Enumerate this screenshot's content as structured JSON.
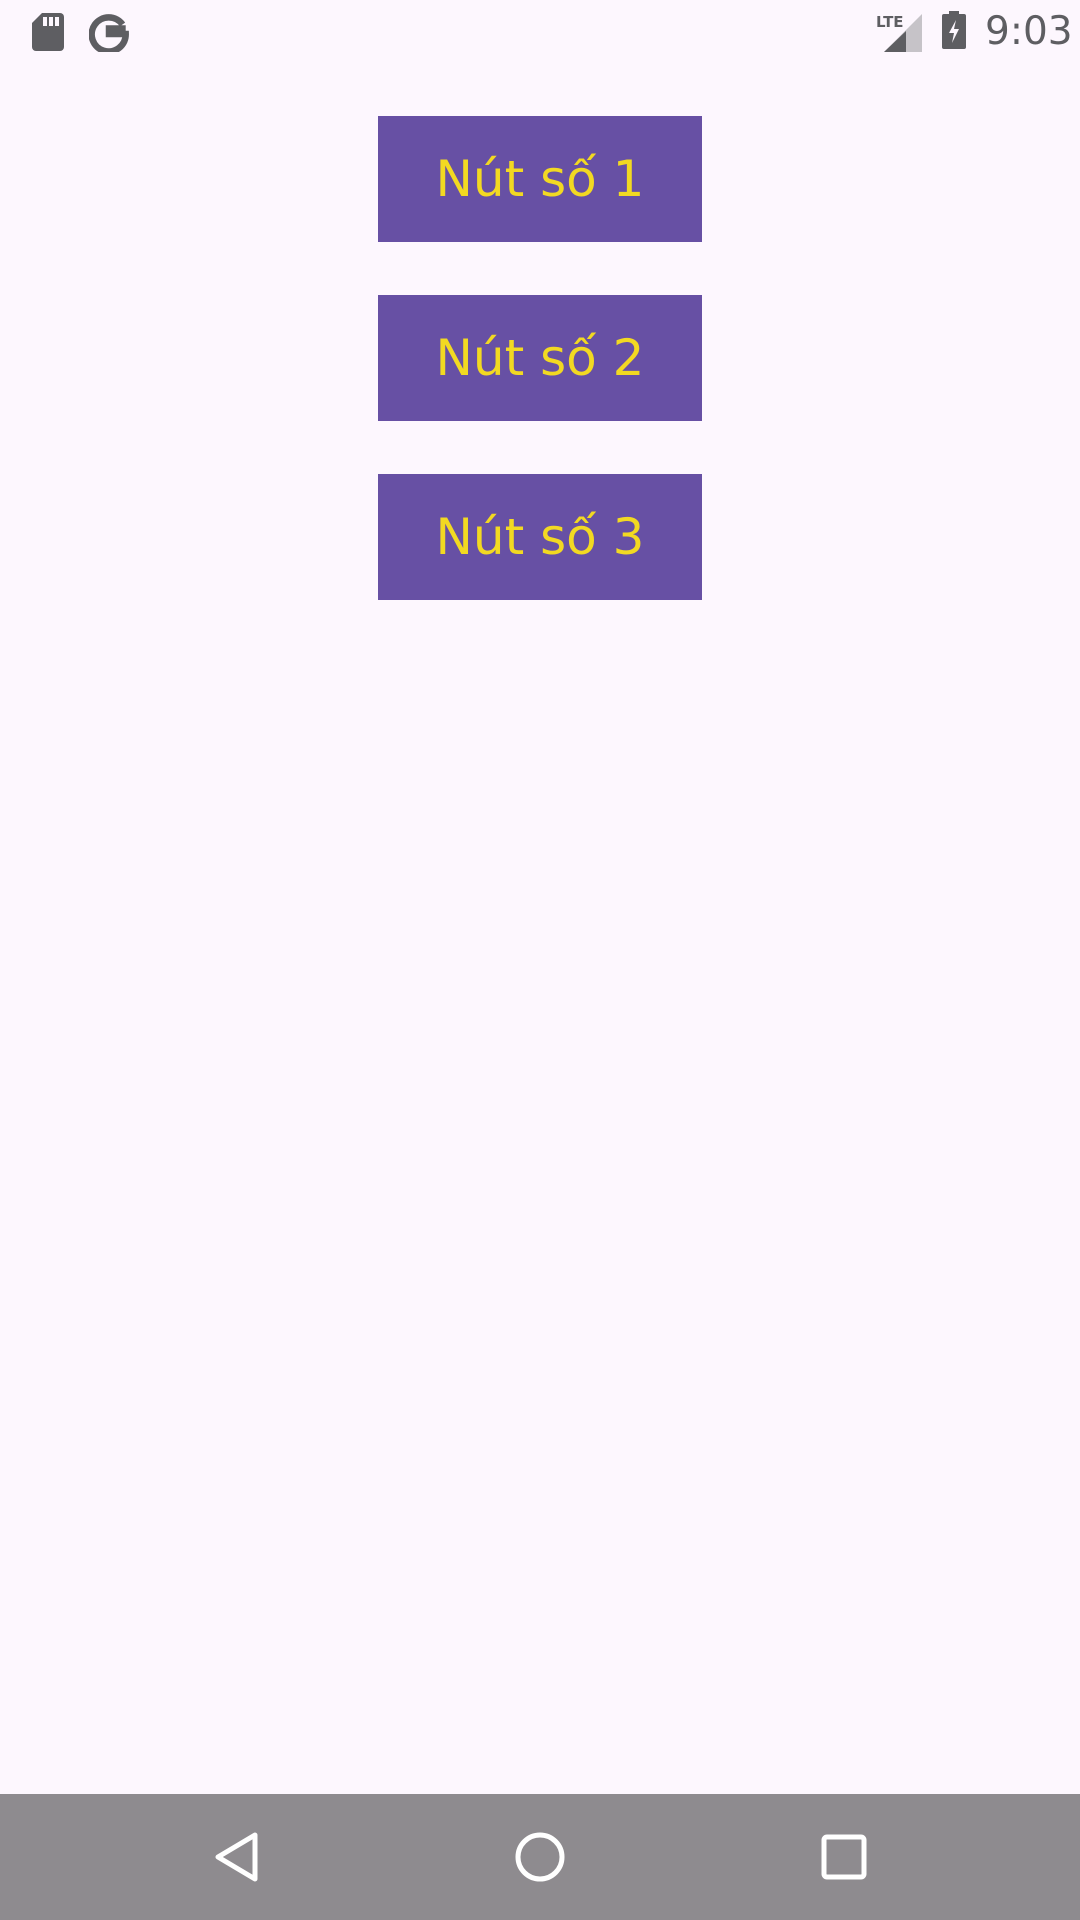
{
  "status_bar": {
    "time": "9:03",
    "network": "LTE",
    "icons": [
      "sdcard-icon",
      "google-icon",
      "lte-signal-icon",
      "battery-charging-icon"
    ]
  },
  "buttons": [
    {
      "label": "Nút số 1"
    },
    {
      "label": "Nút số 2"
    },
    {
      "label": "Nút số 3"
    }
  ],
  "nav_bar": {
    "icons": [
      "back-icon",
      "home-icon",
      "recents-icon"
    ]
  },
  "colors": {
    "background": "#FDF7FE",
    "button_background": "#6750A4",
    "button_text": "#F2D922",
    "nav_bar": "#8E8B8F",
    "status_icons": "#5E5E62"
  }
}
